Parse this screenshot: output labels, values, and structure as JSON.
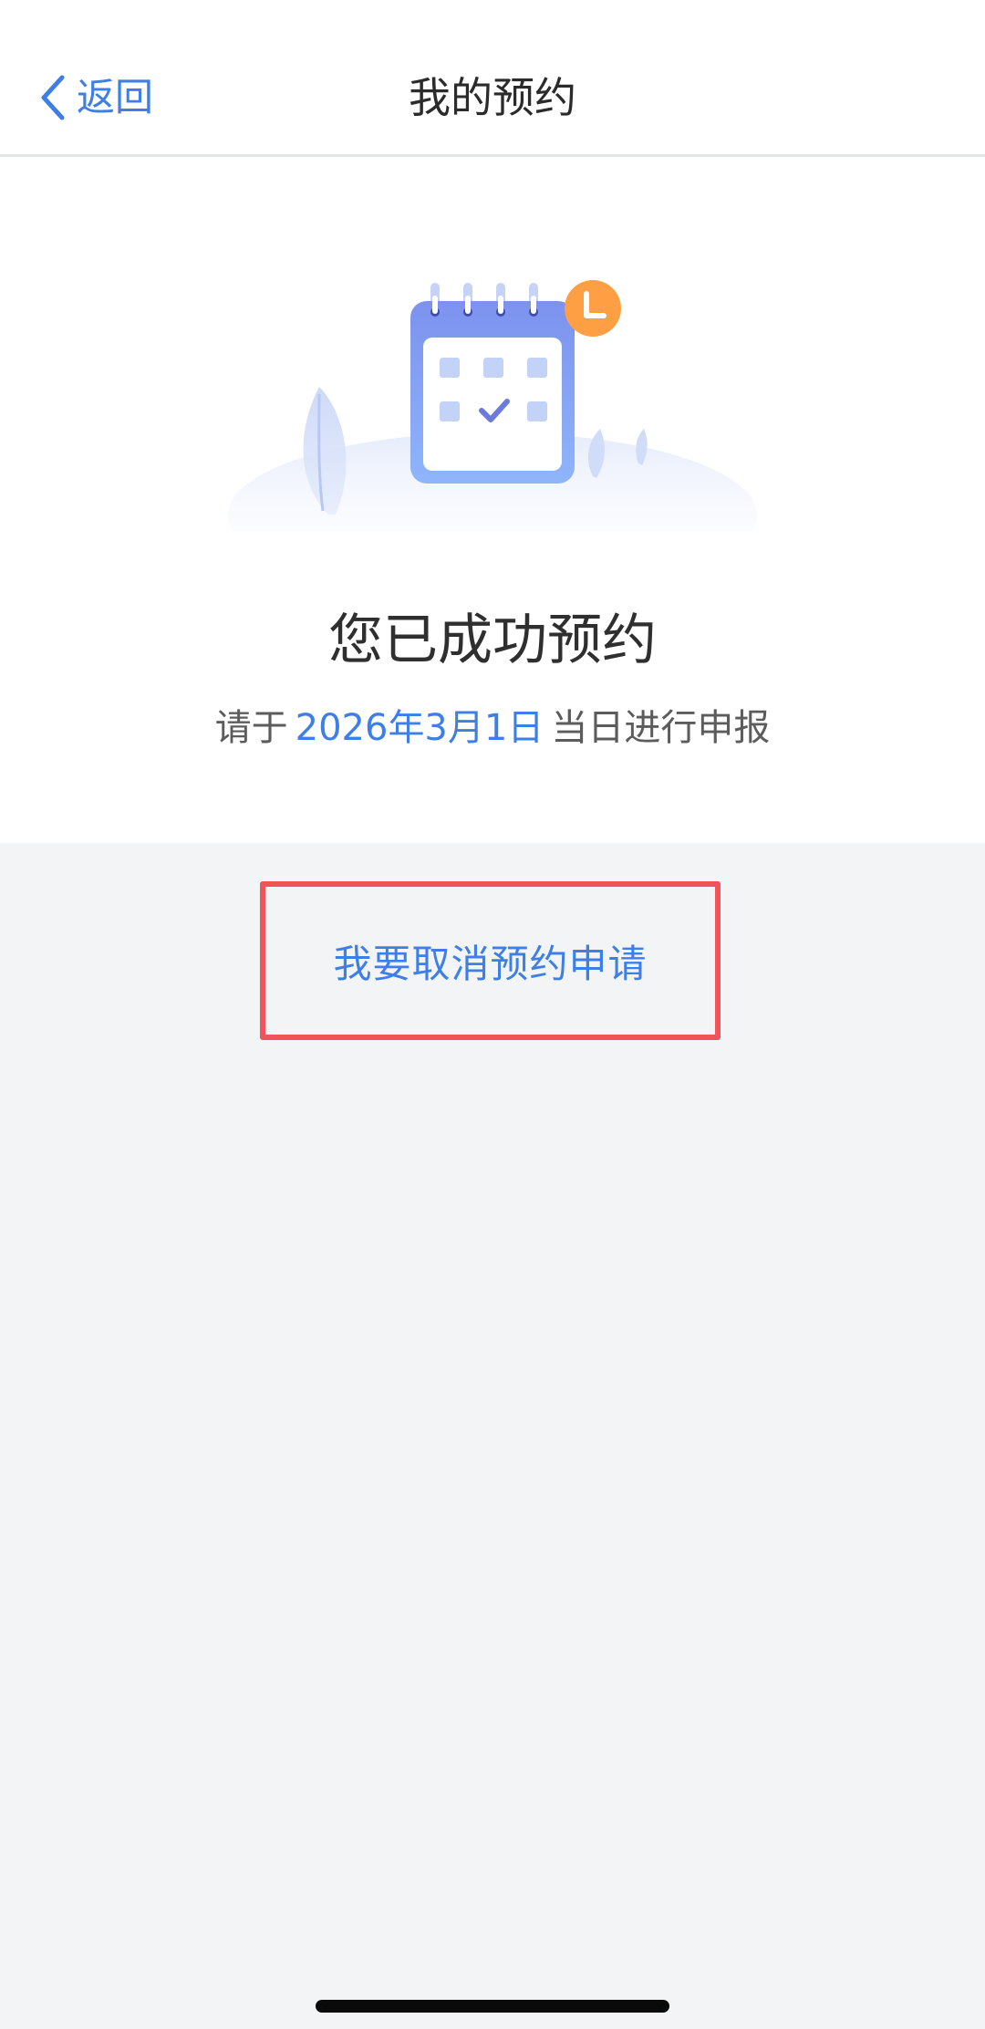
{
  "nav": {
    "back_label": "返回",
    "title": "我的预约"
  },
  "result": {
    "title": "您已成功预约",
    "sub_prefix": "请于",
    "date": "2026年3月1日",
    "sub_suffix": "当日进行申报"
  },
  "actions": {
    "cancel_label": "我要取消预约申请"
  },
  "colors": {
    "accent": "#3d7fe6",
    "highlight_border": "#f0545a",
    "page_bg": "#f3f4f6",
    "clock_badge": "#ff9f43"
  },
  "icons": {
    "back": "chevron-left-icon",
    "illustration": "calendar-clock-illustration"
  }
}
